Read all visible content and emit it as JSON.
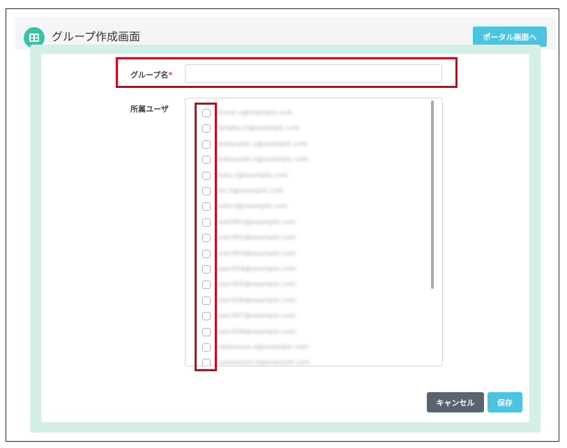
{
  "header": {
    "title": "グループ作成画面",
    "portal_button_label": "ポータル画面へ",
    "icon": "grid-table-icon"
  },
  "form": {
    "group_name_label": "グループ名",
    "required_mark": "*",
    "group_name_value": "",
    "members_label": "所属ユーザ"
  },
  "users": [
    {
      "email": "inoue.s@example.com",
      "checked": false
    },
    {
      "email": "tanaka.m@example.com",
      "checked": false
    },
    {
      "email": "watanabe.y@example.com",
      "checked": false
    },
    {
      "email": "kobayashi.k@example.com",
      "checked": false
    },
    {
      "email": "kato.r@example.com",
      "checked": false
    },
    {
      "email": "ito.h@example.com",
      "checked": false
    },
    {
      "email": "sato.t@example.com",
      "checked": false
    },
    {
      "email": "user001@example.com",
      "checked": false
    },
    {
      "email": "user002@example.com",
      "checked": false
    },
    {
      "email": "user003@example.com",
      "checked": false
    },
    {
      "email": "user004@example.com",
      "checked": false
    },
    {
      "email": "user005@example.com",
      "checked": false
    },
    {
      "email": "user006@example.com",
      "checked": false
    },
    {
      "email": "user007@example.com",
      "checked": false
    },
    {
      "email": "user008@example.com",
      "checked": false
    },
    {
      "email": "nakamura.a@example.com",
      "checked": false
    },
    {
      "email": "yamamoto.k@example.com",
      "checked": false
    }
  ],
  "footer": {
    "cancel_label": "キャンセル",
    "save_label": "保存"
  },
  "colors": {
    "accent": "#4ac4e0",
    "icon_green": "#35c4a5",
    "panel_bg": "#d3efe6",
    "cancel_bg": "#5a6370",
    "highlight_red": "#d0021b"
  }
}
